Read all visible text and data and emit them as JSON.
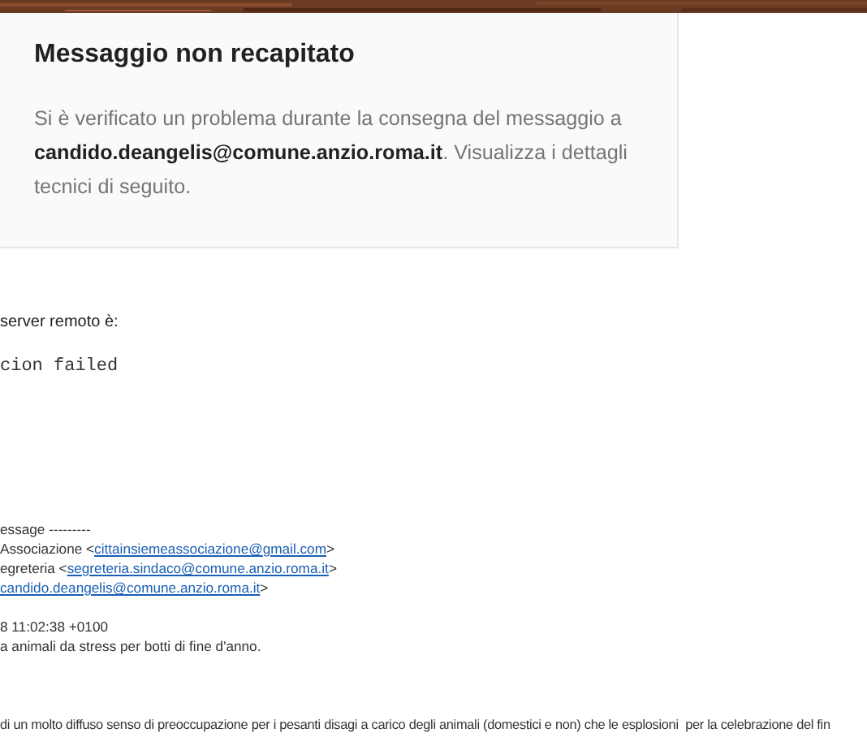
{
  "notice": {
    "title": "Messaggio non recapitato",
    "message": "Si è verificato un problema durante la consegna del messaggio a **candido.deangelis@comune.anzio.roma.it**. Visualizza i dettagli tecnici di seguito."
  },
  "server_response": {
    "label": "server remoto è:",
    "code": "cion failed"
  },
  "forwarded": [
    {
      "text": "essage ---------"
    },
    {
      "text": "Associazione <",
      "link": "cittainsiemeassociazione@gmail.com",
      "after": ">"
    },
    {
      "text": "egreteria <",
      "link": "segreteria.sindaco@comune.anzio.roma.it",
      "after": ">"
    },
    {
      "link": "candido.deangelis@comune.anzio.roma.it",
      "after": ">"
    },
    {
      "text": "8 11:02:38 +0100",
      "gap": true
    },
    {
      "text": "a animali da stress per botti di fine d'anno."
    }
  ],
  "body_line": "di un molto diffuso senso di preoccupazione per i pesanti disagi a carico degli animali (domestici e non) che le esplosioni  per la celebrazione del fin"
}
